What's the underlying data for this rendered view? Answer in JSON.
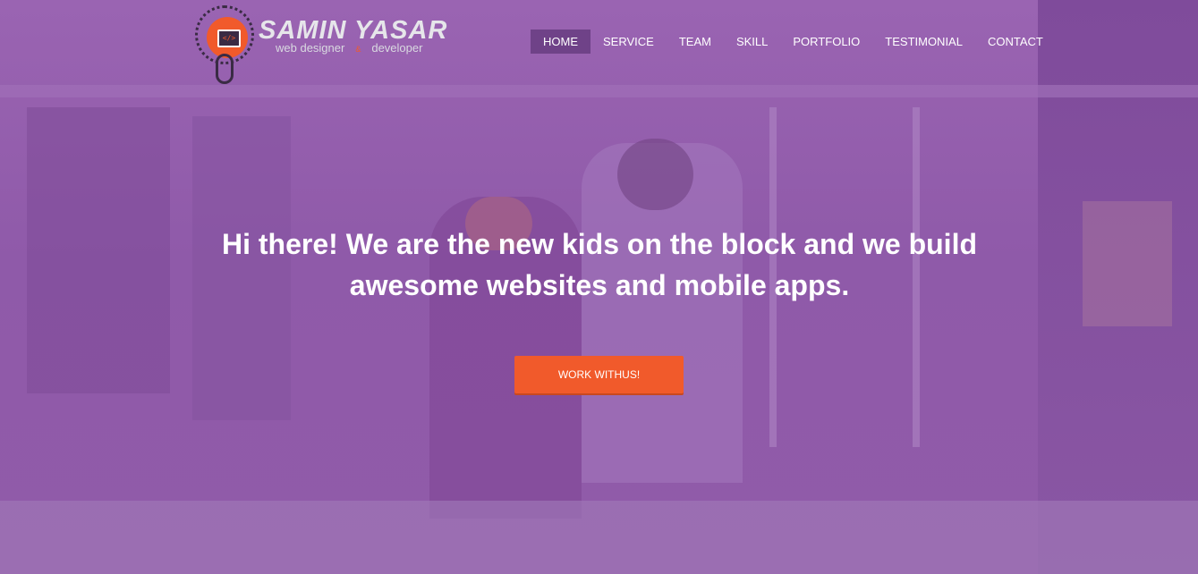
{
  "logo": {
    "icon": "code-screen-mouse-icon",
    "screen_glyph": "</>",
    "name": "SAMIN YASAR",
    "tagline_left": "web designer",
    "tagline_amp": "&",
    "tagline_right": "developer",
    "accent_color": "#f15a2b"
  },
  "nav": {
    "items": [
      {
        "label": "HOME",
        "active": true
      },
      {
        "label": "SERVICE"
      },
      {
        "label": "TEAM"
      },
      {
        "label": "SKILL"
      },
      {
        "label": "PORTFOLIO"
      },
      {
        "label": "TESTIMONIAL"
      },
      {
        "label": "CONTACT"
      }
    ]
  },
  "hero": {
    "headline_line1": "Hi there! We are the new kids on the block and we build",
    "headline_line2": "awesome websites and mobile apps.",
    "cta_label": "WORK WITHUS!",
    "overlay_color": "#8e5aa6",
    "cta_color": "#f15a2b"
  }
}
